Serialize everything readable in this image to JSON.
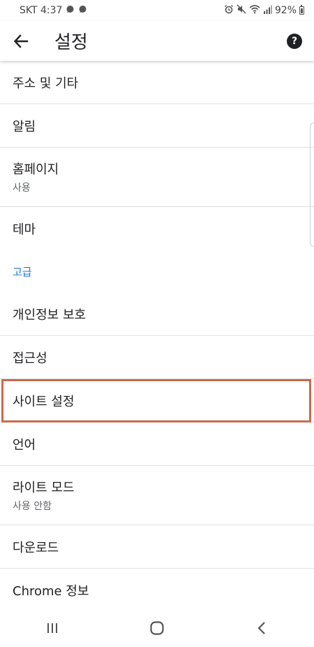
{
  "status_bar": {
    "carrier_time": "SKT 4:37",
    "battery_percent": "92%",
    "icons": [
      "chat-icon",
      "chat-icon",
      "alarm-icon",
      "mute-icon",
      "wifi-icon",
      "signal-icon",
      "battery-icon"
    ]
  },
  "app_bar": {
    "title": "설정",
    "back_icon": "back-arrow-icon",
    "help_icon": "help-icon",
    "help_glyph": "?"
  },
  "settings": {
    "addresses": {
      "title": "주소 및 기타"
    },
    "notifications": {
      "title": "알림"
    },
    "homepage": {
      "title": "홈페이지",
      "subtitle": "사용"
    },
    "theme": {
      "title": "테마"
    },
    "advanced_header": "고급",
    "privacy": {
      "title": "개인정보 보호"
    },
    "accessibility": {
      "title": "접근성"
    },
    "site_settings": {
      "title": "사이트 설정"
    },
    "language": {
      "title": "언어"
    },
    "lite_mode": {
      "title": "라이트 모드",
      "subtitle": "사용 안함"
    },
    "downloads": {
      "title": "다운로드"
    },
    "about_chrome": {
      "title": "Chrome 정보"
    }
  },
  "colors": {
    "accent": "#1a73e8",
    "highlight_border": "#c96a4b"
  },
  "nav_bar": {
    "icons": [
      "recents-icon",
      "home-icon",
      "back-icon"
    ]
  }
}
